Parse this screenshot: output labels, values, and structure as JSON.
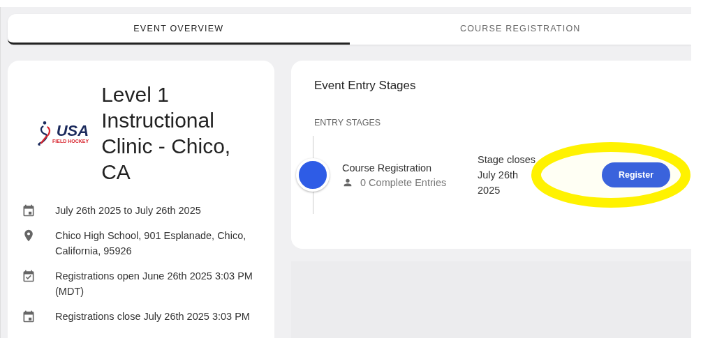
{
  "tabs": [
    {
      "label": "EVENT OVERVIEW",
      "selected": true
    },
    {
      "label": "COURSE REGISTRATION",
      "selected": false
    }
  ],
  "event": {
    "logo": {
      "wordmark": "USA",
      "subtitle": "FIELD HOCKEY"
    },
    "title": "Level 1 Instructional Clinic - Chico, CA",
    "details": [
      {
        "kind": "dates",
        "text": "July 26th 2025 to July 26th 2025"
      },
      {
        "kind": "location",
        "text": "Chico High School, 901 Esplanade, Chico, California, 95926"
      },
      {
        "kind": "opens",
        "text": "Registrations open June 26th 2025 3:03 PM (MDT)"
      },
      {
        "kind": "closes",
        "text": "Registrations close July 26th 2025 3:03 PM"
      }
    ]
  },
  "stages_card": {
    "title": "Event Entry Stages",
    "section_label": "ENTRY STAGES",
    "stages": [
      {
        "name": "Course Registration",
        "entries": "0 Complete Entries",
        "closes_label": "Stage closes July 26th 2025",
        "button": "Register"
      }
    ]
  }
}
